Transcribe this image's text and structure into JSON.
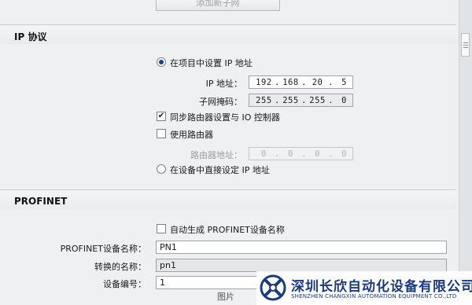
{
  "top": {
    "add_subnet_label": "添加新子网"
  },
  "ip_section": {
    "title": "IP 协议",
    "radio_project": "在项目中设置 IP 地址",
    "ip_label": "IP 地址：",
    "ip": [
      "192",
      "168",
      "20",
      "5"
    ],
    "mask_label": "子网掩码：",
    "mask": [
      "255",
      "255",
      "255",
      "0"
    ],
    "sync_router_label": "同步路由器设置与 IO 控制器",
    "use_router_label": "使用路由器",
    "router_addr_label": "路由器地址：",
    "router": [
      "0",
      "0",
      "0",
      "0"
    ],
    "radio_device": "在设备中直接设定 IP 地址"
  },
  "profinet": {
    "title": "PROFINET",
    "auto_name_label": "自动生成 PROFINET设备名称",
    "device_name_label": "PROFINET设备名称：",
    "device_name_value": "PN1",
    "converted_name_label": "转换的名称：",
    "converted_name_value": "pn1",
    "device_number_label": "设备编号：",
    "device_number_value": "1"
  },
  "watermark": {
    "company_cn": "深圳长欣自动化设备有限公司",
    "company_en": "SHENZHEN CHANGXIN AUTOMATION EQUIPMENT CO.,LTD",
    "caption": "图片"
  },
  "colors": {
    "brand": "#1d3a78",
    "radio_dot": "#1a3f8a"
  }
}
